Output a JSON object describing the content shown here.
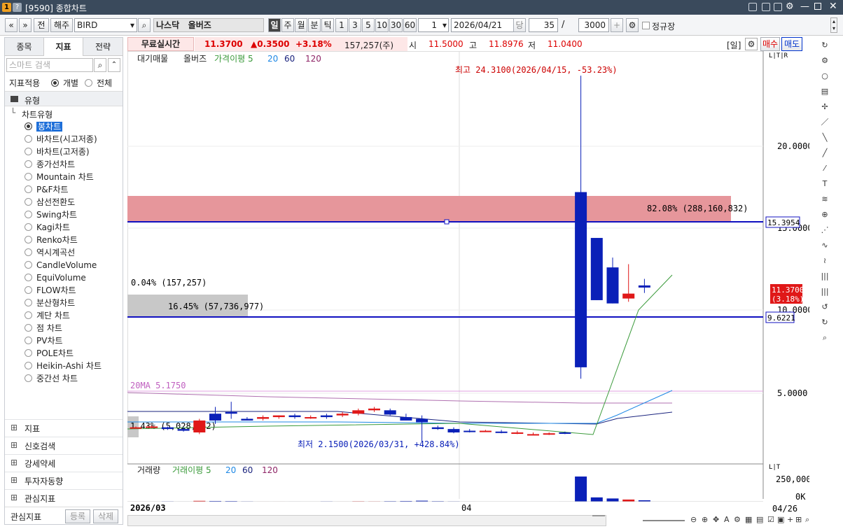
{
  "window": {
    "title": "[9590] 종합차트",
    "icons": [
      "new-window-icon",
      "pin-icon",
      "camera-icon",
      "gear-icon",
      "minimize-icon",
      "restore-icon",
      "close-icon"
    ]
  },
  "toolbar": {
    "nav_prev": "«",
    "nav_down": "»",
    "btn_jeon": "전",
    "btn_haeju": "해주",
    "symbol": "BIRD",
    "market_name": "나스닥",
    "stock_name": "올버즈",
    "periods": [
      "일",
      "주",
      "월",
      "분",
      "틱"
    ],
    "intervals": [
      "1",
      "3",
      "5",
      "10",
      "30",
      "60"
    ],
    "interval_value": "1",
    "date": "2026/04/21",
    "btn_dang": "당",
    "count": "35",
    "total": "3000",
    "regular_label": "정규장"
  },
  "left_panel": {
    "tabs": [
      "종목",
      "지표",
      "전략"
    ],
    "search_placeholder": "스마트 검색",
    "apply_label": "지표적용",
    "opt_individual": "개별",
    "opt_all": "전체",
    "section_type": "유형",
    "chart_type_header": "차트유형",
    "chart_types": [
      "봉차트",
      "바차트(시고저종)",
      "바차트(고저종)",
      "종가선차트",
      "Mountain 차트",
      "P&F차트",
      "삼선전환도",
      "Swing차트",
      "Kagi차트",
      "Renko차트",
      "역시계곡선",
      "CandleVolume",
      "EquiVolume",
      "FLOW차트",
      "분산형차트",
      "계단 차트",
      "점 차트",
      "PV차트",
      "POLE차트",
      "Heikin-Ashi 차트",
      "중간선 차트"
    ],
    "selected_type": "봉차트",
    "folders": [
      "지표",
      "신호검색",
      "강세약세",
      "투자자동향",
      "관심지표"
    ],
    "fav_label": "관심지표",
    "btn_register": "등록",
    "btn_delete": "삭제"
  },
  "infobar": {
    "realtime": "무료실시간",
    "price": "11.3700",
    "change": "▲0.3500",
    "change_pct": "+3.18%",
    "volume": "157,257(주)",
    "open_label": "시",
    "open": "11.5000",
    "high_label": "고",
    "high": "11.8976",
    "low_label": "저",
    "low": "11.0400",
    "period_tag": "[일]",
    "buy": "매수",
    "sell": "매도"
  },
  "chart_data": {
    "type": "candlestick",
    "legend": [
      "대기매물",
      "올버즈",
      "가격이평 5",
      "20",
      "60",
      "120"
    ],
    "legend_colors": [
      "#222",
      "#222",
      "#3a9a3a",
      "#1e88e5",
      "#1a237e",
      "#8e2466"
    ],
    "y_ticks": [
      "20.0000",
      "15.0000",
      "10.0000",
      "5.0000"
    ],
    "x_ticks": [
      "2026/03",
      "04",
      "04/26"
    ],
    "price_labels": {
      "current": "11.3700",
      "current_pct": "(3.18%)",
      "line1": "15.3954",
      "line2": "9.6221"
    },
    "annotations": {
      "max": "최고 24.3100(2026/04/15, -53.23%)",
      "min": "최저 2.1500(2026/03/31, +428.84%)",
      "ma20": "20MA 5.1750"
    },
    "profile": [
      {
        "label": "82.08% (288,160,832)",
        "pct": 82.08
      },
      {
        "label": "0.04% (157,257)",
        "pct": 0.04
      },
      {
        "label": "16.45% (57,736,977)",
        "pct": 16.45
      },
      {
        "label": "1.43% (5,028,162)",
        "pct": 1.43
      }
    ],
    "candles": [
      [
        3.0,
        3.05,
        2.95,
        3.0
      ],
      [
        3.0,
        3.1,
        2.95,
        3.05
      ],
      [
        3.0,
        3.05,
        2.85,
        2.9
      ],
      [
        2.9,
        3.0,
        2.75,
        2.8
      ],
      [
        2.7,
        3.5,
        2.6,
        3.4
      ],
      [
        3.8,
        4.2,
        3.2,
        3.4
      ],
      [
        3.9,
        4.5,
        3.5,
        3.8
      ],
      [
        3.5,
        3.6,
        3.4,
        3.4
      ],
      [
        3.5,
        3.7,
        3.4,
        3.6
      ],
      [
        3.6,
        3.7,
        3.5,
        3.7
      ],
      [
        3.7,
        3.8,
        3.5,
        3.6
      ],
      [
        3.6,
        3.7,
        3.5,
        3.6
      ],
      [
        3.7,
        3.8,
        3.5,
        3.6
      ],
      [
        3.7,
        3.9,
        3.6,
        3.8
      ],
      [
        3.8,
        4.1,
        3.7,
        4.0
      ],
      [
        4.0,
        4.2,
        3.9,
        4.1
      ],
      [
        4.0,
        4.1,
        3.7,
        3.75
      ],
      [
        3.6,
        3.8,
        3.4,
        3.4
      ],
      [
        3.5,
        3.7,
        2.15,
        3.3
      ],
      [
        3.0,
        3.1,
        2.85,
        2.9
      ],
      [
        2.9,
        3.0,
        2.65,
        2.7
      ],
      [
        2.8,
        2.9,
        2.7,
        2.75
      ],
      [
        2.8,
        2.85,
        2.75,
        2.8
      ],
      [
        2.75,
        2.85,
        2.65,
        2.7
      ],
      [
        2.7,
        2.8,
        2.6,
        2.7
      ],
      [
        2.6,
        2.7,
        2.55,
        2.6
      ],
      [
        2.6,
        2.7,
        2.55,
        2.65
      ],
      [
        2.7,
        2.75,
        2.6,
        2.65
      ],
      [
        17.2,
        24.31,
        5.8,
        6.5
      ],
      [
        14.4,
        14.4,
        10.6,
        10.6
      ],
      [
        12.6,
        13.2,
        10.4,
        10.4
      ],
      [
        10.7,
        12.8,
        10.5,
        11.0
      ],
      [
        11.5,
        11.9,
        11.04,
        11.37
      ]
    ],
    "volume_ticks": [
      "250,000K",
      "0K"
    ],
    "volume_legend": [
      "거래량",
      "거래이평 5",
      "20",
      "60",
      "120"
    ],
    "volume": [
      5,
      4,
      6,
      5,
      12,
      10,
      9,
      6,
      5,
      5,
      5,
      4,
      6,
      5,
      7,
      6,
      8,
      10,
      14,
      8,
      6,
      5,
      4,
      4,
      4,
      3,
      4,
      5,
      350,
      60,
      45,
      30,
      20
    ]
  },
  "right_tools": [
    "refresh-icon",
    "gear-icon",
    "circle-icon",
    "bar-chart-icon",
    "crosshair-icon",
    "line-tool-icon",
    "ray-icon",
    "trendline-icon",
    "auto-trend-icon",
    "text-tool-icon",
    "fibonacci-icon",
    "zoom-icon",
    "fib-fan-icon",
    "pattern-icon",
    "zigzag-icon",
    "vertical-lines-icon",
    "grid-lines-icon",
    "undo-icon",
    "redo-icon",
    "search-icon"
  ],
  "bottom": {
    "btns": [
      "▸",
      "|◂",
      "▮▮",
      "▸|"
    ]
  }
}
